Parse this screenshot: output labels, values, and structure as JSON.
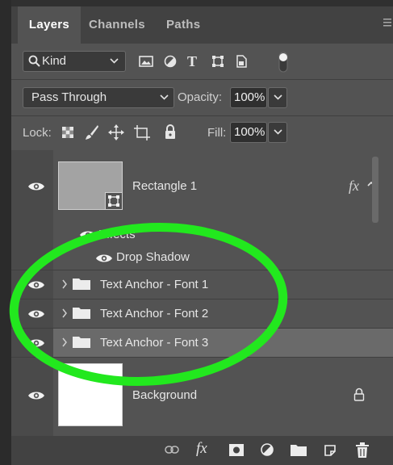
{
  "tabs": [
    {
      "label": "Layers",
      "active": true
    },
    {
      "label": "Channels",
      "active": false
    },
    {
      "label": "Paths",
      "active": false
    }
  ],
  "panel_menu_icon": "hamburger-icon",
  "filter": {
    "kind_label": "Kind",
    "icons": [
      "image-filter-icon",
      "adjustment-filter-icon",
      "type-filter-icon",
      "shape-filter-icon",
      "smart-object-filter-icon",
      "filter-toggle-icon"
    ]
  },
  "blend": {
    "mode": "Pass Through",
    "opacity_label": "Opacity:",
    "opacity_value": "100%"
  },
  "lock": {
    "label": "Lock:",
    "icons": [
      "lock-transparent-icon",
      "lock-image-icon",
      "lock-position-icon",
      "lock-artboard-icon",
      "lock-all-icon"
    ],
    "fill_label": "Fill:",
    "fill_value": "100%"
  },
  "layers": {
    "rectangle": {
      "name": "Rectangle 1",
      "fx": "fx",
      "effects_label": "Effects",
      "effect": "Drop Shadow"
    },
    "groups": [
      {
        "name": "Text Anchor - Font 1",
        "selected": false
      },
      {
        "name": "Text Anchor - Font 2",
        "selected": false
      },
      {
        "name": "Text Anchor - Font 3",
        "selected": true
      }
    ],
    "background": {
      "name": "Background"
    }
  },
  "bottom_icons": [
    "link-icon",
    "fx-icon",
    "mask-icon",
    "adjustment-icon",
    "folder-icon",
    "new-layer-icon",
    "trash-icon"
  ],
  "annotation": {
    "color": "#22e81e",
    "shape": "ellipse"
  },
  "colors": {
    "panel": "#535353",
    "selected_row": "#6a6a6a",
    "accent_green": "#22e81e"
  }
}
